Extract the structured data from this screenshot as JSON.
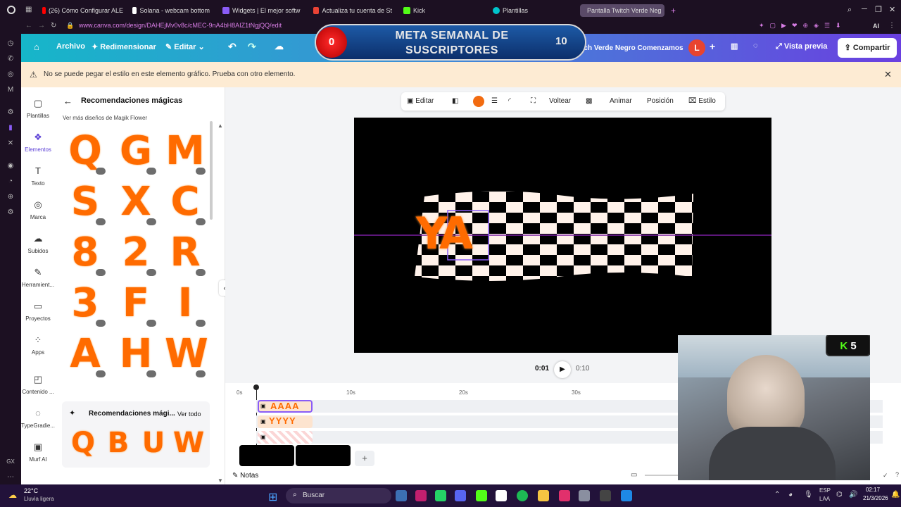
{
  "browser": {
    "tabs": [
      {
        "label": "(26) Cómo Configurar ALE",
        "color": "#ff0000"
      },
      {
        "label": "Solana - webcam bottom",
        "color": "#ffffff"
      },
      {
        "label": "Widgets | El mejor softw",
        "color": "#8a5cf6"
      },
      {
        "label": "Actualiza tu cuenta de St",
        "color": "#ea4335"
      },
      {
        "label": "Kick",
        "color": "#53fc18"
      },
      {
        "label": "Plantillas",
        "color": "#00c4cc"
      },
      {
        "label": "Pantalla Twitch Verde Neg",
        "color": "#8a5cf6"
      }
    ],
    "url": "www.canva.com/design/DAHEjMv0v8c/cMEC-9nA4bH8AIZ1tNgjQQ/edit",
    "addr_right": "AI"
  },
  "toolbar": {
    "archivo": "Archivo",
    "redimensionar": "Redimensionar",
    "editar": "Editar",
    "design_title": "Pantalla Twitch Verde Negro Comenzamos",
    "avatar": "L",
    "vista_previa": "Vista previa",
    "compartir": "Compartir"
  },
  "overlay": {
    "count": "0",
    "title_line1": "META SEMANAL DE",
    "title_line2": "SUSCRIPTORES",
    "goal": "10"
  },
  "warning": {
    "message": "No se puede pegar el estilo en este elemento gráfico. Prueba con otro elemento."
  },
  "rail": [
    {
      "label": "Plantillas",
      "icon": "▢"
    },
    {
      "label": "Elementos",
      "icon": "❖"
    },
    {
      "label": "Texto",
      "icon": "T"
    },
    {
      "label": "Marca",
      "icon": "◎"
    },
    {
      "label": "Subidos",
      "icon": "☁"
    },
    {
      "label": "Herramient...",
      "icon": "✎"
    },
    {
      "label": "Proyectos",
      "icon": "▭"
    },
    {
      "label": "Apps",
      "icon": "⁘"
    },
    {
      "label": "Contenido ...",
      "icon": "◰"
    },
    {
      "label": "TypeGradie...",
      "icon": "◌"
    },
    {
      "label": "Murf AI",
      "icon": "▣"
    }
  ],
  "panel": {
    "title": "Recomendaciones mágicas",
    "subtitle": "Ver más diseños de Magik Flower",
    "letters": [
      "Q",
      "G",
      "M",
      "S",
      "X",
      "C",
      "8",
      "2",
      "R",
      "3",
      "F",
      "I",
      "A",
      "H",
      "W"
    ],
    "section_title": "Recomendaciones mági...",
    "see_all": "Ver todo",
    "rec_letters": [
      "Q",
      "B",
      "U",
      "W"
    ]
  },
  "context_toolbar": {
    "editar": "Editar",
    "voltear": "Voltear",
    "animar": "Animar",
    "posicion": "Posición",
    "estilo": "Estilo",
    "color": "#f26b10"
  },
  "stage": {
    "letters": "YA"
  },
  "playback": {
    "current": "0:01",
    "total": "0:10"
  },
  "timeline": {
    "ticks": [
      "0s",
      "10s",
      "20s",
      "30s"
    ],
    "track1": "AAAA",
    "track2": "YYYY",
    "notes": "Notas"
  },
  "webcam": {
    "badge": "5"
  },
  "taskbar": {
    "weather_temp": "22°C",
    "weather_desc": "Lluvia ligera",
    "search": "Buscar",
    "lang1": "ESP",
    "lang2": "LAA",
    "time": "02:17",
    "date": "21/3/2026"
  }
}
